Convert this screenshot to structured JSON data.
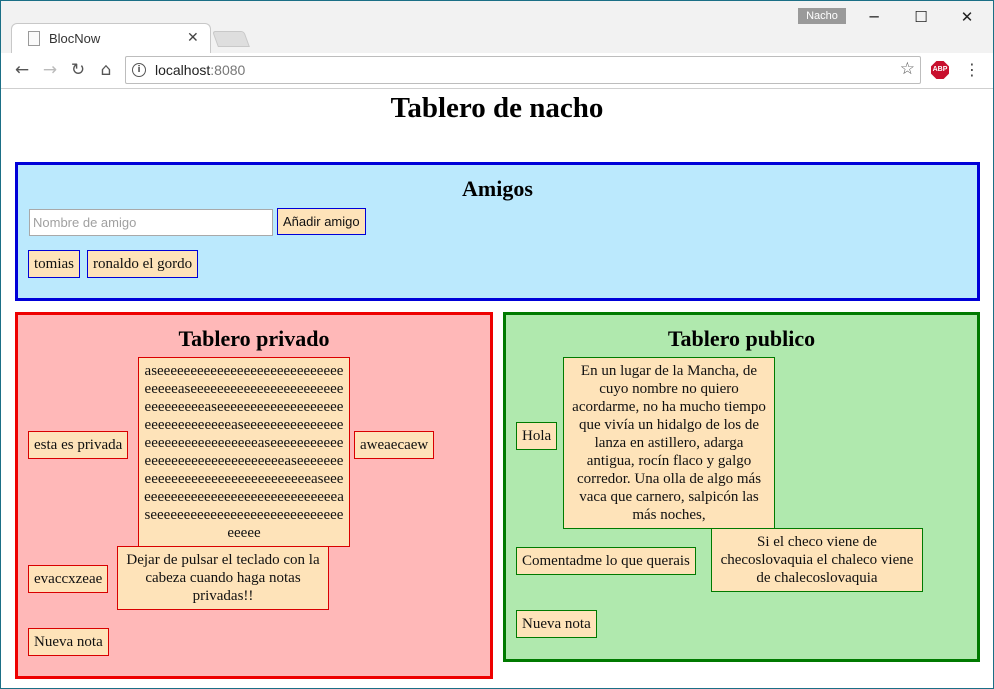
{
  "browser": {
    "tab_title": "BlocNow",
    "tab_close": "✕",
    "profile_name": "Nacho",
    "url_host": "localhost",
    "url_port": ":8080",
    "window_controls": {
      "minimize": "─",
      "maximize": "☐",
      "close": "✕"
    },
    "icons": {
      "back": "←",
      "forward": "→",
      "reload": "↻",
      "home": "⌂",
      "info": "i",
      "star": "☆",
      "abp": "ABP",
      "menu": "⋮"
    }
  },
  "page": {
    "title": "Tablero de nacho",
    "friends": {
      "heading": "Amigos",
      "input_placeholder": "Nombre de amigo",
      "add_button": "Añadir amigo",
      "list": [
        "tomias",
        "ronaldo el gordo"
      ]
    },
    "private_board": {
      "heading": "Tablero privado",
      "notes": [
        "esta es privada",
        "aseeeeeeeeeeeeeeeeeeeeeeeeeeeeeeeeeaseeeeeeeeeeeeeeeeeeeeeeeeeeeeeeeeaseeeeeeeeeeeeeeeeeeeeeeeeeeeeeeeeaseeeeeeeeeeeeeeeeeeeeeeeeeeeeeeeeaseeeeeeeeeeeeeeeeeeeeeeeeeeeeeeeeaseeeeeeeeeeeeeeeeeeeeeeeeeeeeeeeeaseeeeeeeeeeeeeeeeeeeeeeeeeeeeeeeeaseeeeeeeeeeeeeeeeeeeeeeeeeeeeeeeeee",
        "aweaecaew",
        "evaccxzeae",
        "Dejar de pulsar el teclado con la cabeza cuando haga notas privadas!!"
      ],
      "new_note": "Nueva nota"
    },
    "public_board": {
      "heading": "Tablero publico",
      "notes": [
        "Hola",
        "En un lugar de la Mancha, de cuyo nombre no quiero acordarme, no ha mucho tiempo que vivía un hidalgo de los de lanza en astillero, adarga antigua, rocín flaco y galgo corredor. Una olla de algo más vaca que carnero, salpicón las más noches,",
        "Comentadme lo que querais",
        "Si el checo viene de checoslovaquia el chaleco viene de chalecoslovaquia"
      ],
      "new_note": "Nueva nota"
    }
  },
  "colors": {
    "friends_bg": "#bbe9fd",
    "friends_border": "#0000d8",
    "private_bg": "#ffb8b8",
    "private_border": "#ee0000",
    "public_bg": "#b0e9ae",
    "public_border": "#007a00",
    "note_bg": "#fee3b9"
  }
}
